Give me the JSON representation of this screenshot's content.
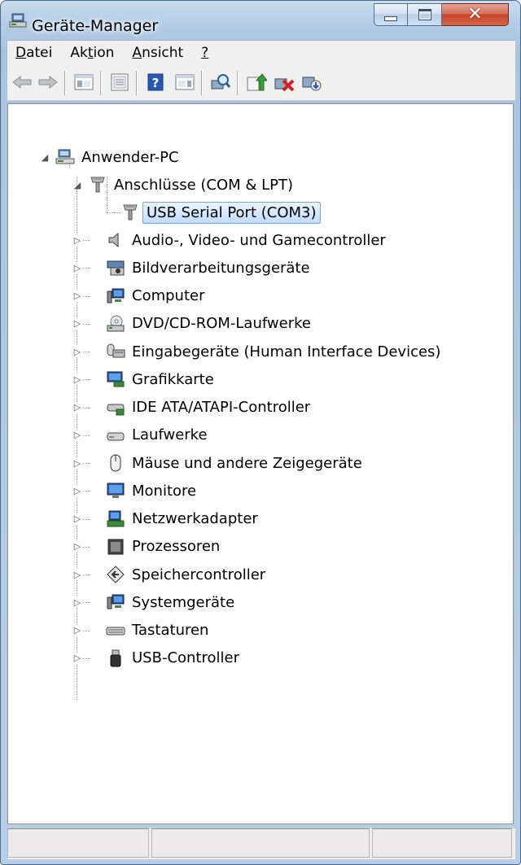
{
  "window": {
    "title": "Geräte-Manager"
  },
  "menu": [
    {
      "label": "Datei",
      "u": "D",
      "rest": "atei"
    },
    {
      "label": "Aktion",
      "pre": "Ak",
      "u": "t",
      "rest": "ion"
    },
    {
      "label": "Ansicht",
      "u": "A",
      "rest": "nsicht"
    },
    {
      "label": "?",
      "u": "?",
      "rest": ""
    }
  ],
  "tree": {
    "root": "Anwender-PC",
    "expanded_category": "Anschlüsse (COM & LPT)",
    "selected_device": "USB Serial Port (COM3)",
    "categories": [
      "Audio-, Video- und Gamecontroller",
      "Bildverarbeitungsgeräte",
      "Computer",
      "DVD/CD-ROM-Laufwerke",
      "Eingabegeräte (Human Interface Devices)",
      "Grafikkarte",
      "IDE ATA/ATAPI-Controller",
      "Laufwerke",
      "Mäuse und andere Zeigegeräte",
      "Monitore",
      "Netzwerkadapter",
      "Prozessoren",
      "Speichercontroller",
      "Systemgeräte",
      "Tastaturen",
      "USB-Controller"
    ],
    "category_icons": [
      "speaker-icon",
      "camera-icon",
      "computer-icon",
      "dvd-drive-icon",
      "keyboard-mouse-icon",
      "display-adapter-icon",
      "ide-controller-icon",
      "disk-drive-icon",
      "mouse-icon",
      "monitor-icon",
      "network-adapter-icon",
      "processor-icon",
      "storage-controller-icon",
      "system-device-icon",
      "keyboard-icon",
      "usb-plug-icon"
    ]
  },
  "colors": {
    "selection_border": "#7da2ce",
    "close_red": "#c6452b"
  }
}
